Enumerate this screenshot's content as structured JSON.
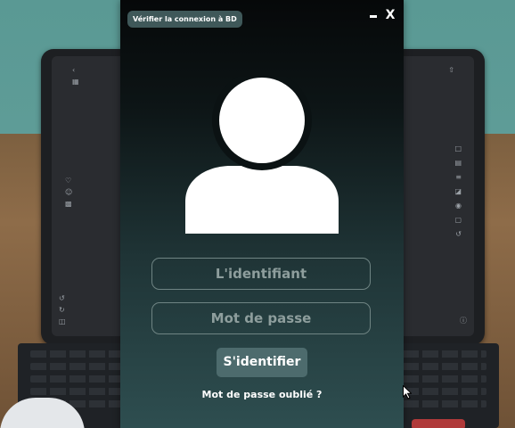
{
  "window": {
    "db_check_label": "Vérifier la connexion à BD",
    "minimize_icon": "minimize-icon",
    "close_label": "X"
  },
  "avatar": {
    "icon": "user-silhouette-icon"
  },
  "form": {
    "username_placeholder": "L'identifiant",
    "password_placeholder": "Mot de passe",
    "login_label": "S'identifier",
    "forgot_label": "Mot de passe oublié ?"
  },
  "colors": {
    "button_bg": "#4d6b6d",
    "db_button_bg": "#3f5859",
    "field_border": "#6f8483",
    "window_top": "#060809",
    "window_bottom": "#2e4e50"
  }
}
